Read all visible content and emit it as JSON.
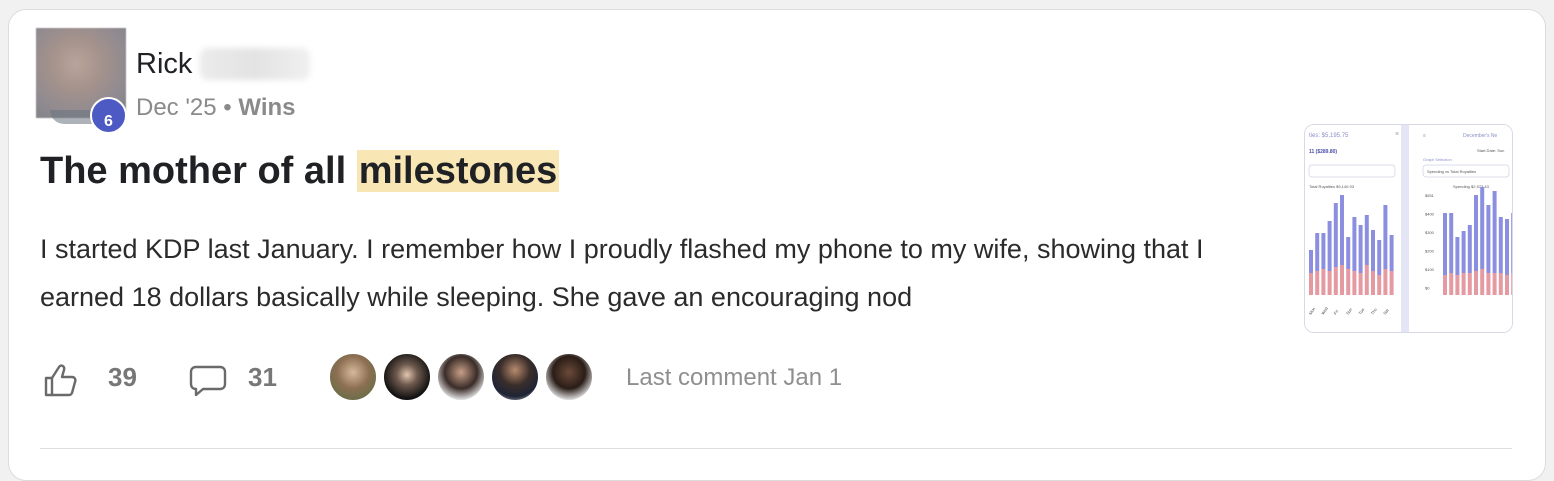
{
  "post": {
    "author_first_name": "Rick",
    "author_level": "6",
    "date": "Dec '25",
    "separator": "•",
    "category": "Wins",
    "title_prefix": "The mother of all ",
    "title_highlight": "milestones",
    "body": "I started KDP last January. I remember how I proudly flashed my phone to my wife, showing that I earned 18 dollars basically while sleeping. She gave an encouraging nod"
  },
  "thumbnail": {
    "left_panel": {
      "header": "ties: $5,195.75",
      "sub_value": "11 ($289.80)",
      "legend": "Total Royalties $9,140.93",
      "x_labels": [
        "Mon",
        "Wed",
        "Fri",
        "Sun",
        "Tue",
        "Thu",
        "Sat"
      ]
    },
    "right_panel": {
      "header": "December's Ne",
      "date_label": "Start Date: Sun",
      "graph_selection_label": "Graph Selection",
      "graph_selection_value": "Spending vs Total Royalties",
      "legend_spending": "Spending $2,973.43",
      "y_labels": [
        "$551",
        "$400",
        "$300",
        "$200",
        "$100",
        "$0"
      ]
    }
  },
  "stats": {
    "likes": "39",
    "comments": "31",
    "last_comment": "Last comment Jan 1"
  },
  "icons": {
    "like": "thumbs-up-icon",
    "comment": "speech-bubble-icon"
  },
  "colors": {
    "highlight": "#f8e7b4",
    "level_badge": "#4e5ac4",
    "bar_blue": "#8c8fe0",
    "bar_red": "#e59aa2"
  }
}
